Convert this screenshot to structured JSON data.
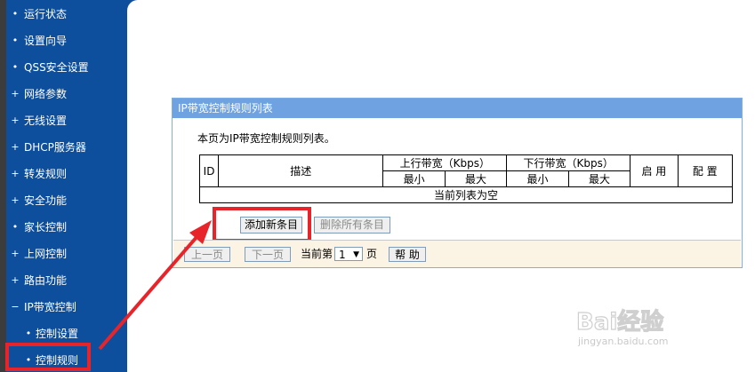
{
  "sidebar": {
    "items": [
      {
        "label": "运行状态",
        "bullet": "•"
      },
      {
        "label": "设置向导",
        "bullet": "•"
      },
      {
        "label": "QSS安全设置",
        "bullet": "•"
      },
      {
        "label": "网络参数",
        "bullet": "+"
      },
      {
        "label": "无线设置",
        "bullet": "+"
      },
      {
        "label": "DHCP服务器",
        "bullet": "+"
      },
      {
        "label": "转发规则",
        "bullet": "+"
      },
      {
        "label": "安全功能",
        "bullet": "+"
      },
      {
        "label": "家长控制",
        "bullet": "•"
      },
      {
        "label": "上网控制",
        "bullet": "+"
      },
      {
        "label": "路由功能",
        "bullet": "+"
      },
      {
        "label": "IP带宽控制",
        "bullet": "−"
      },
      {
        "label": "控制设置",
        "bullet": "•"
      },
      {
        "label": "控制规则",
        "bullet": "•"
      }
    ]
  },
  "panel": {
    "title": "IP带宽控制规则列表",
    "description": "本页为IP带宽控制规则列表。",
    "table": {
      "headers": {
        "id": "ID",
        "desc": "描述",
        "up": "上行带宽（Kbps）",
        "down": "下行带宽（Kbps）",
        "enable": "启 用",
        "config": "配 置",
        "up_min": "最小",
        "up_max": "最大",
        "down_min": "最小",
        "down_max": "最大"
      },
      "empty_text": "当前列表为空"
    },
    "buttons": {
      "add": "添加新条目",
      "delete_all": "删除所有条目"
    },
    "pagination": {
      "prev": "上一页",
      "next": "下一页",
      "current_label": "当前第",
      "page_value": "1",
      "page_suffix": "页",
      "help": "帮 助"
    }
  },
  "watermark": {
    "logo_text": "Bai经验",
    "url": "jingyan.baidu.com"
  },
  "colors": {
    "sidebar": "#0d4f9c",
    "panel_title": "#6fa2e0",
    "highlight": "#e8242b",
    "nav_bar": "#fbf3e3"
  }
}
